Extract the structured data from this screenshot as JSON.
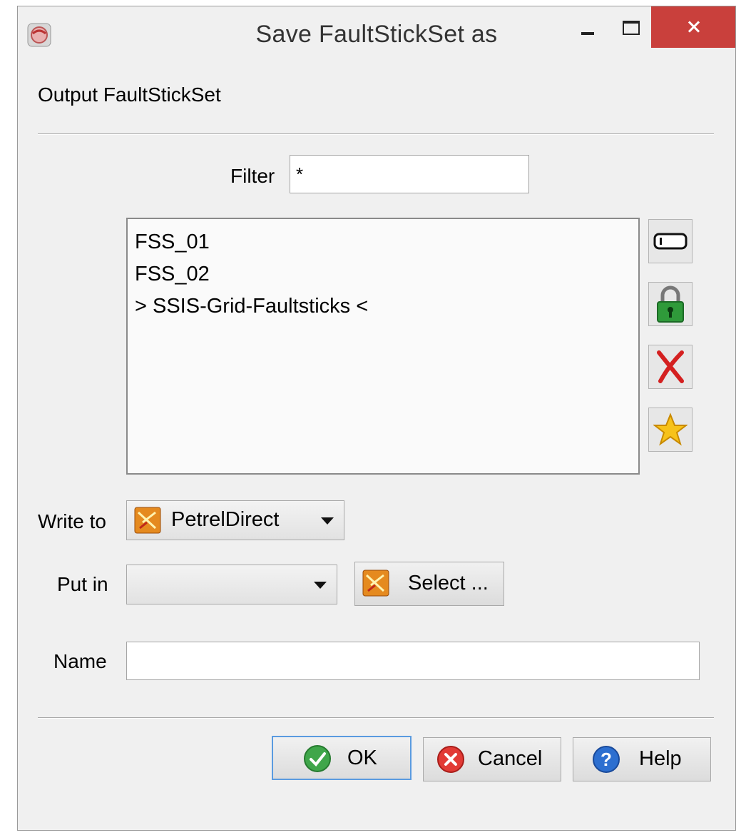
{
  "window": {
    "title": "Save FaultStickSet as"
  },
  "section": {
    "label": "Output FaultStickSet"
  },
  "filter": {
    "label": "Filter",
    "value": "*"
  },
  "list": {
    "items": [
      "FSS_01",
      "FSS_02",
      "> SSIS-Grid-Faultsticks <"
    ]
  },
  "side_buttons": [
    "rename-icon",
    "lock-icon",
    "delete-icon",
    "favorite-icon"
  ],
  "write_to": {
    "label": "Write to",
    "value": "PetrelDirect"
  },
  "put_in": {
    "label": "Put in",
    "value": "",
    "select_label": "Select ..."
  },
  "name": {
    "label": "Name",
    "value": ""
  },
  "buttons": {
    "ok": "OK",
    "cancel": "Cancel",
    "help": "Help"
  },
  "colors": {
    "close_button": "#c9403c",
    "ok_focus": "#5a9be0"
  }
}
